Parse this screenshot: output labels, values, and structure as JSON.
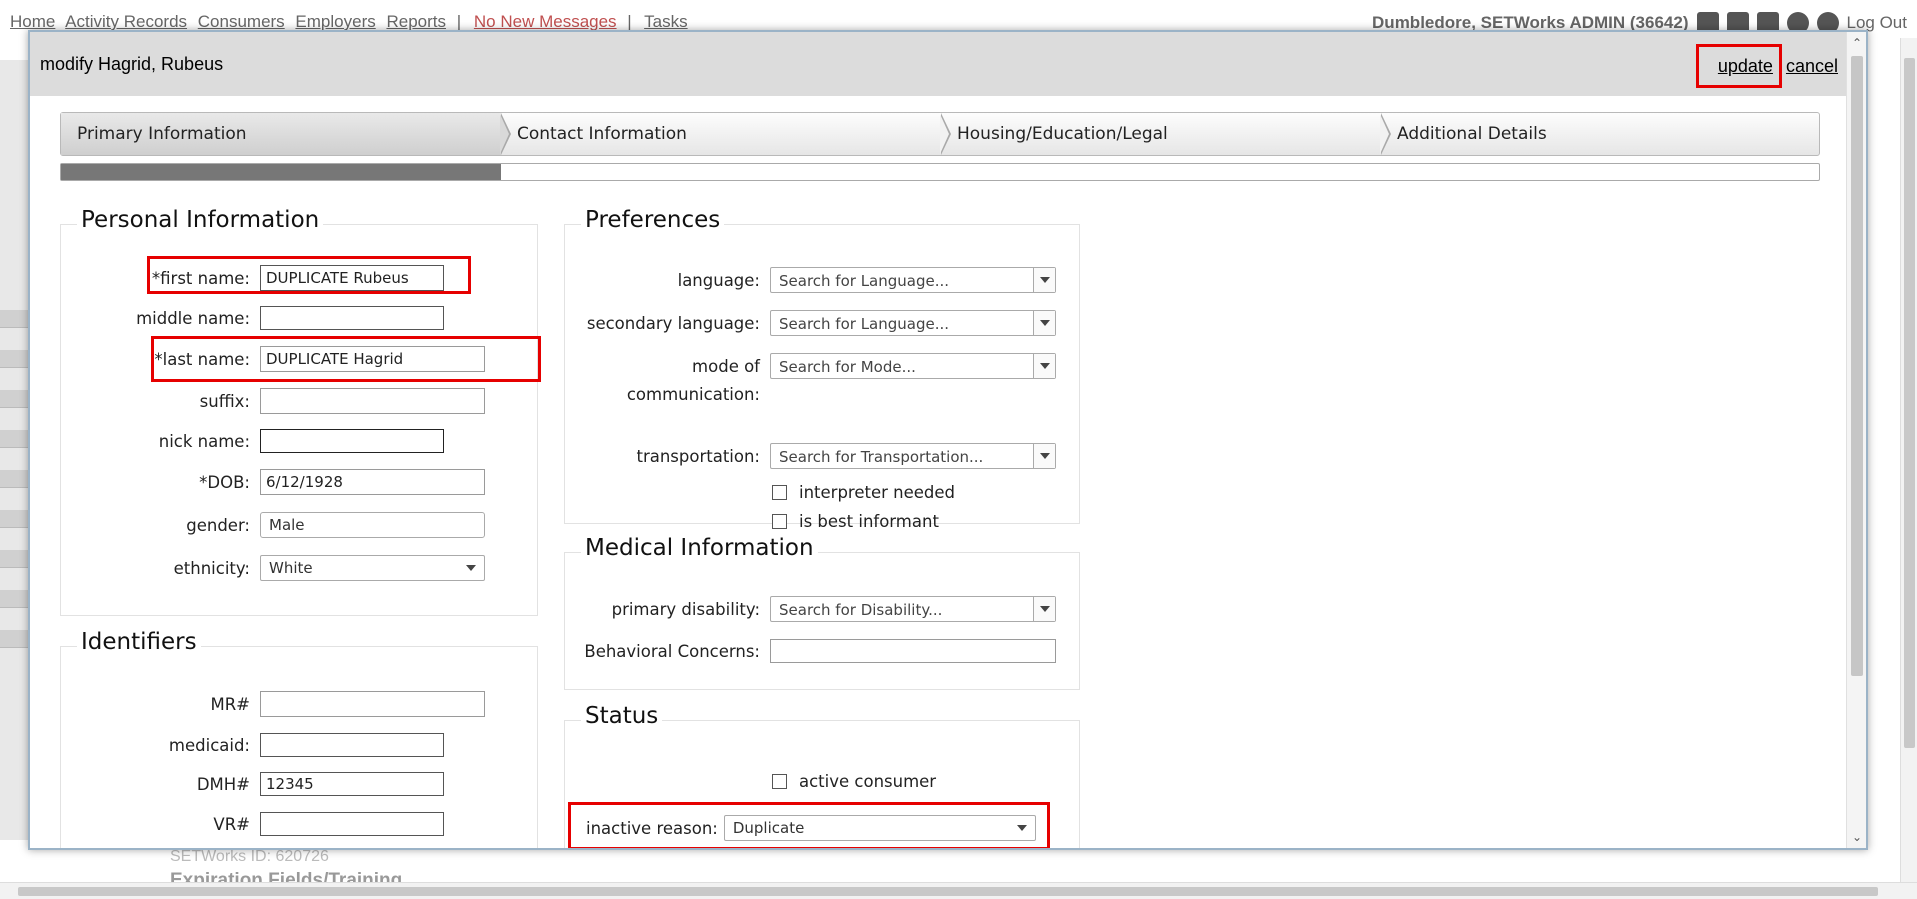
{
  "nav": {
    "items": [
      "Home",
      "Activity Records",
      "Consumers",
      "Employers",
      "Reports"
    ],
    "messages": "No New Messages",
    "tasks": "Tasks",
    "user": "Dumbledore, SETWorks ADMIN (36642)",
    "logout": "Log Out"
  },
  "background": {
    "faded_text": "SETWorks ID:          620726",
    "faded_section": "Expiration Fields/Training"
  },
  "modal": {
    "title": "modify Hagrid, Rubeus",
    "update": "update",
    "cancel": "cancel"
  },
  "wizard": {
    "steps": [
      "Primary Information",
      "Contact Information",
      "Housing/Education/Legal",
      "Additional Details"
    ],
    "progress": 0.25
  },
  "personal": {
    "title": "Personal Information",
    "first_name_label": "*first name:",
    "first_name": "DUPLICATE Rubeus",
    "middle_name_label": "middle name:",
    "middle_name": "",
    "last_name_label": "*last name:",
    "last_name": "DUPLICATE Hagrid",
    "suffix_label": "suffix:",
    "suffix": "",
    "nick_name_label": "nick name:",
    "nick_name": "",
    "dob_label": "*DOB:",
    "dob": "6/12/1928",
    "gender_label": "gender:",
    "gender": "Male",
    "ethnicity_label": "ethnicity:",
    "ethnicity": "White"
  },
  "identifiers": {
    "title": "Identifiers",
    "mr_label": "MR#",
    "mr": "",
    "medicaid_label": "medicaid:",
    "medicaid": "",
    "dmh_label": "DMH#",
    "dmh": "12345",
    "vr_label": "VR#",
    "vr": ""
  },
  "preferences": {
    "title": "Preferences",
    "language_label": "language:",
    "language_ph": "Search for Language...",
    "secondary_language_label": "secondary language:",
    "secondary_language_ph": "Search for Language...",
    "mode_label_1": "mode of",
    "mode_label_2": "communication:",
    "mode_ph": "Search for Mode...",
    "transportation_label": "transportation:",
    "transportation_ph": "Search for Transportation...",
    "interpreter": "interpreter needed",
    "best_informant": "is best informant"
  },
  "medical": {
    "title": "Medical Information",
    "primary_disability_label": "primary disability:",
    "primary_disability_ph": "Search for Disability...",
    "behavioral_label": "Behavioral Concerns:",
    "behavioral": ""
  },
  "status": {
    "title": "Status",
    "active_consumer": "active consumer",
    "inactive_reason_label": "inactive reason:",
    "inactive_reason": "Duplicate"
  },
  "colors": {
    "highlight": "#e60000",
    "progress_fill": "#777777",
    "header_bg": "#dcdcdc"
  }
}
